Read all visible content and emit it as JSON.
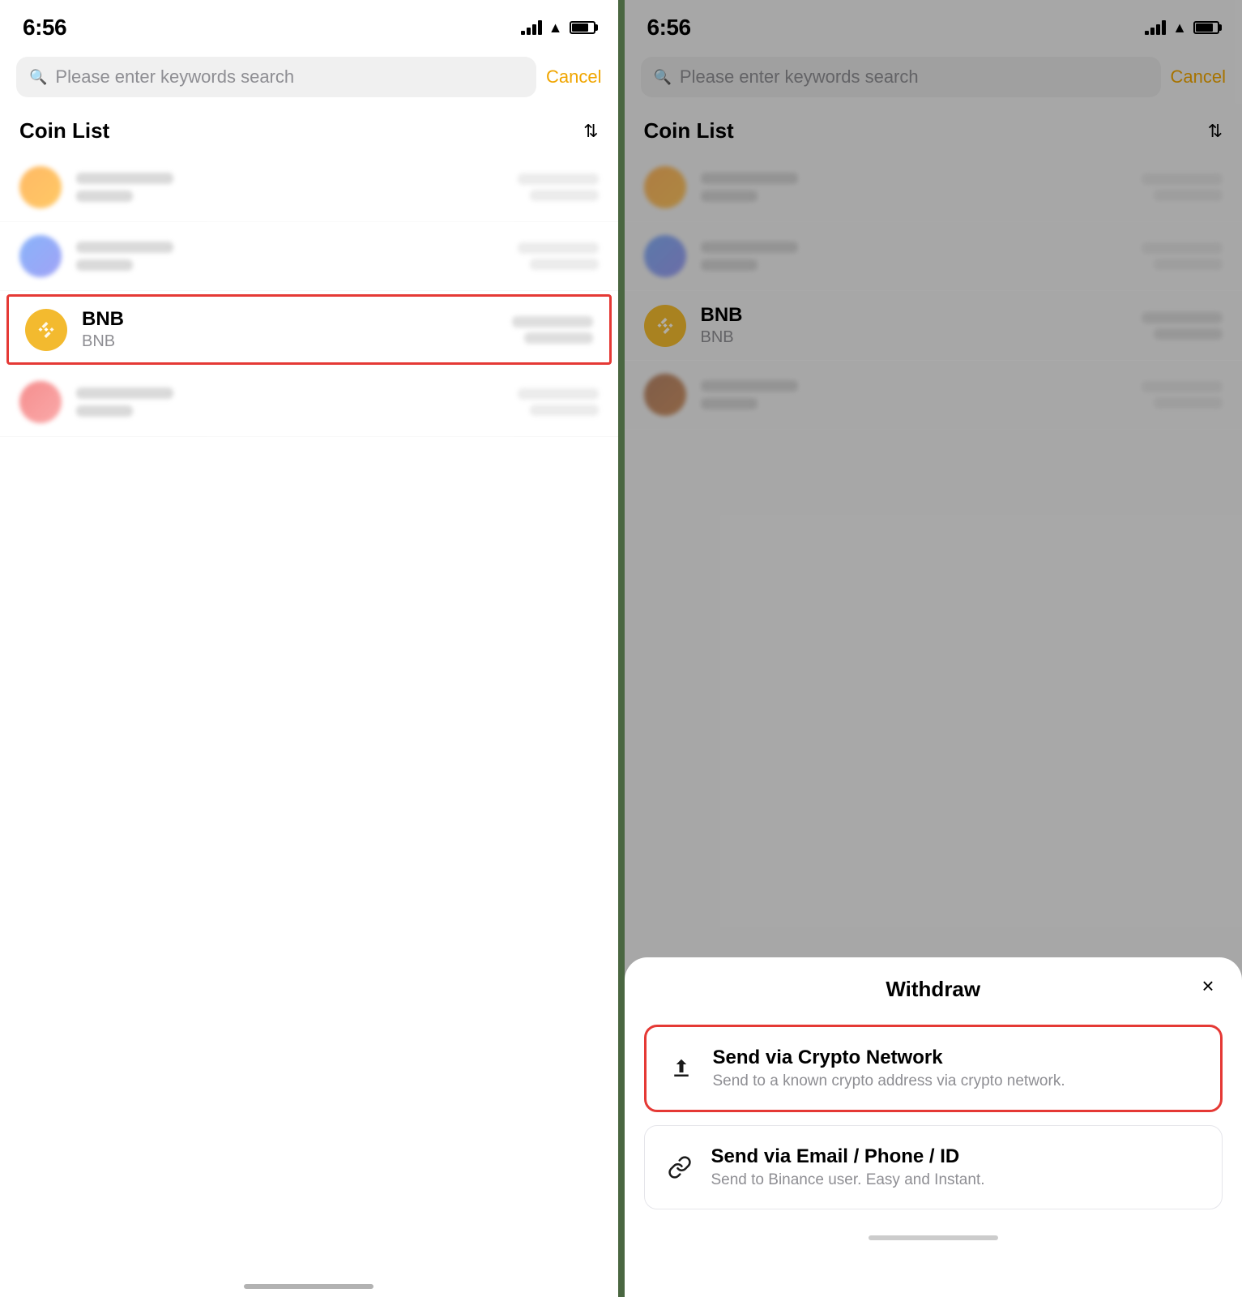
{
  "left_panel": {
    "time": "6:56",
    "search_placeholder": "Please enter keywords search",
    "cancel_label": "Cancel",
    "coin_list_title": "Coin List",
    "coins": [
      {
        "id": "blurred1",
        "type": "orange",
        "blurred": true
      },
      {
        "id": "blurred2",
        "type": "blue",
        "blurred": true
      },
      {
        "id": "bnb",
        "name": "BNB",
        "ticker": "BNB",
        "type": "bnb",
        "blurred": false,
        "highlighted": true
      },
      {
        "id": "blurred3",
        "type": "red",
        "blurred": true
      }
    ]
  },
  "right_panel": {
    "time": "6:56",
    "search_placeholder": "Please enter keywords search",
    "cancel_label": "Cancel",
    "coin_list_title": "Coin List",
    "coins": [
      {
        "id": "blurred1",
        "type": "orange",
        "blurred": true
      },
      {
        "id": "blurred2",
        "type": "blue",
        "blurred": true
      },
      {
        "id": "bnb",
        "name": "BNB",
        "ticker": "BNB",
        "type": "bnb",
        "blurred": false,
        "highlighted": false
      },
      {
        "id": "blurred3",
        "type": "brown",
        "blurred": true
      }
    ],
    "bottom_sheet": {
      "title": "Withdraw",
      "close_label": "×",
      "options": [
        {
          "id": "crypto-network",
          "icon": "upload",
          "title": "Send via Crypto Network",
          "description": "Send to a known crypto address via crypto network.",
          "highlighted": true
        },
        {
          "id": "email-phone",
          "icon": "link",
          "title": "Send via Email / Phone / ID",
          "description": "Send to Binance user. Easy and Instant.",
          "highlighted": false
        }
      ]
    }
  },
  "colors": {
    "accent": "#f0a500",
    "highlight_border": "#e53935",
    "text_primary": "#000000",
    "text_secondary": "#8e8e93"
  }
}
